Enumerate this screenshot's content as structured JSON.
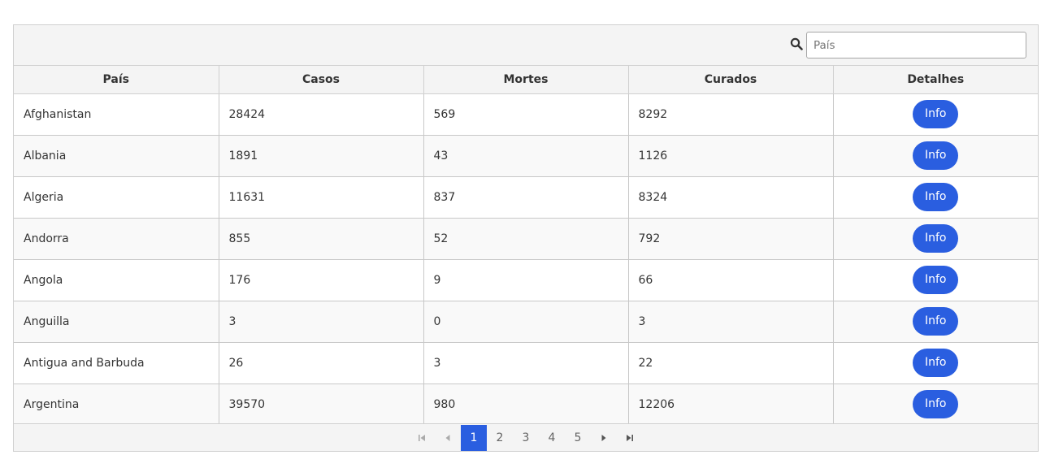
{
  "search": {
    "placeholder": "País"
  },
  "columns": [
    "País",
    "Casos",
    "Mortes",
    "Curados",
    "Detalhes"
  ],
  "rows": [
    {
      "country": "Afghanistan",
      "cases": "28424",
      "deaths": "569",
      "recovered": "8292",
      "action": "Info"
    },
    {
      "country": "Albania",
      "cases": "1891",
      "deaths": "43",
      "recovered": "1126",
      "action": "Info"
    },
    {
      "country": "Algeria",
      "cases": "11631",
      "deaths": "837",
      "recovered": "8324",
      "action": "Info"
    },
    {
      "country": "Andorra",
      "cases": "855",
      "deaths": "52",
      "recovered": "792",
      "action": "Info"
    },
    {
      "country": "Angola",
      "cases": "176",
      "deaths": "9",
      "recovered": "66",
      "action": "Info"
    },
    {
      "country": "Anguilla",
      "cases": "3",
      "deaths": "0",
      "recovered": "3",
      "action": "Info"
    },
    {
      "country": "Antigua and Barbuda",
      "cases": "26",
      "deaths": "3",
      "recovered": "22",
      "action": "Info"
    },
    {
      "country": "Argentina",
      "cases": "39570",
      "deaths": "980",
      "recovered": "12206",
      "action": "Info"
    }
  ],
  "pagination": {
    "pages": [
      "1",
      "2",
      "3",
      "4",
      "5"
    ],
    "current": "1"
  },
  "colors": {
    "accent": "#2a5ee0",
    "header_bg": "#f4f4f4",
    "border": "#d0d0d0"
  },
  "icons": {
    "search": "search-icon",
    "first": "first-page-icon",
    "prev": "prev-page-icon",
    "next": "next-page-icon",
    "last": "last-page-icon"
  }
}
